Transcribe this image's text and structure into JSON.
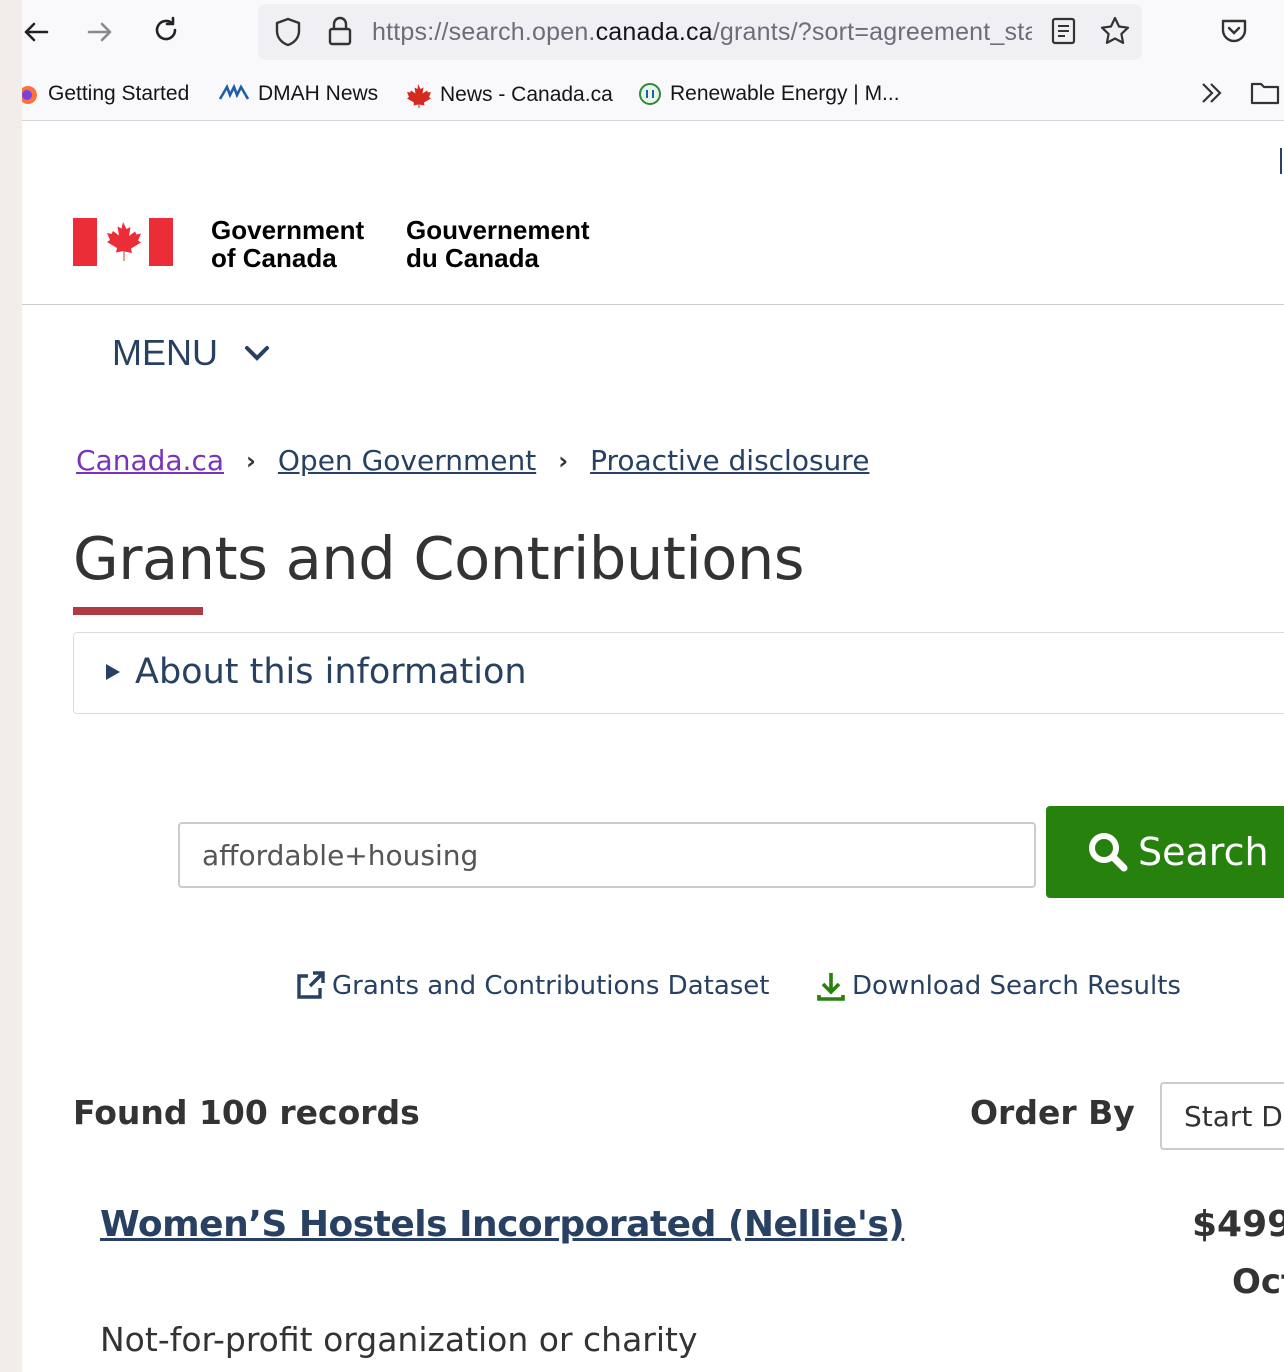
{
  "browser": {
    "url_prefix": "https://search.open.",
    "url_domain": "canada.ca",
    "url_suffix": "/grants/?sort=agreement_sta",
    "bookmarks": [
      {
        "label": "Getting Started",
        "icon": "firefox-icon"
      },
      {
        "label": "DMAH News",
        "icon": "dmah-icon"
      },
      {
        "label": "News - Canada.ca",
        "icon": "maple-leaf-icon"
      },
      {
        "label": "Renewable Energy | M...",
        "icon": "globe-icon"
      }
    ]
  },
  "header": {
    "gov_en_line1": "Government",
    "gov_en_line2": "of Canada",
    "gov_fr_line1": "Gouvernement",
    "gov_fr_line2": "du Canada",
    "menu_label": "MENU"
  },
  "breadcrumb": [
    "Canada.ca",
    "Open Government",
    "Proactive disclosure"
  ],
  "page": {
    "title": "Grants and Contributions",
    "about_label": "About this information"
  },
  "search": {
    "query": "affordable+housing",
    "button_label": "Search"
  },
  "links": {
    "dataset": "Grants and Contributions Dataset",
    "download": "Download Search Results"
  },
  "results": {
    "found_text": "Found 100 records",
    "order_by_label": "Order By",
    "order_by_value": "Start Da",
    "items": [
      {
        "title": "Women’S Hostels Incorporated (Nellie's)",
        "amount": "$499",
        "date": "Oct",
        "type": "Not-for-profit organization or charity"
      }
    ]
  },
  "colors": {
    "link": "#284162",
    "search_green": "#26820d",
    "title_accent": "#af3c43",
    "flag_red": "#eb2d37"
  }
}
